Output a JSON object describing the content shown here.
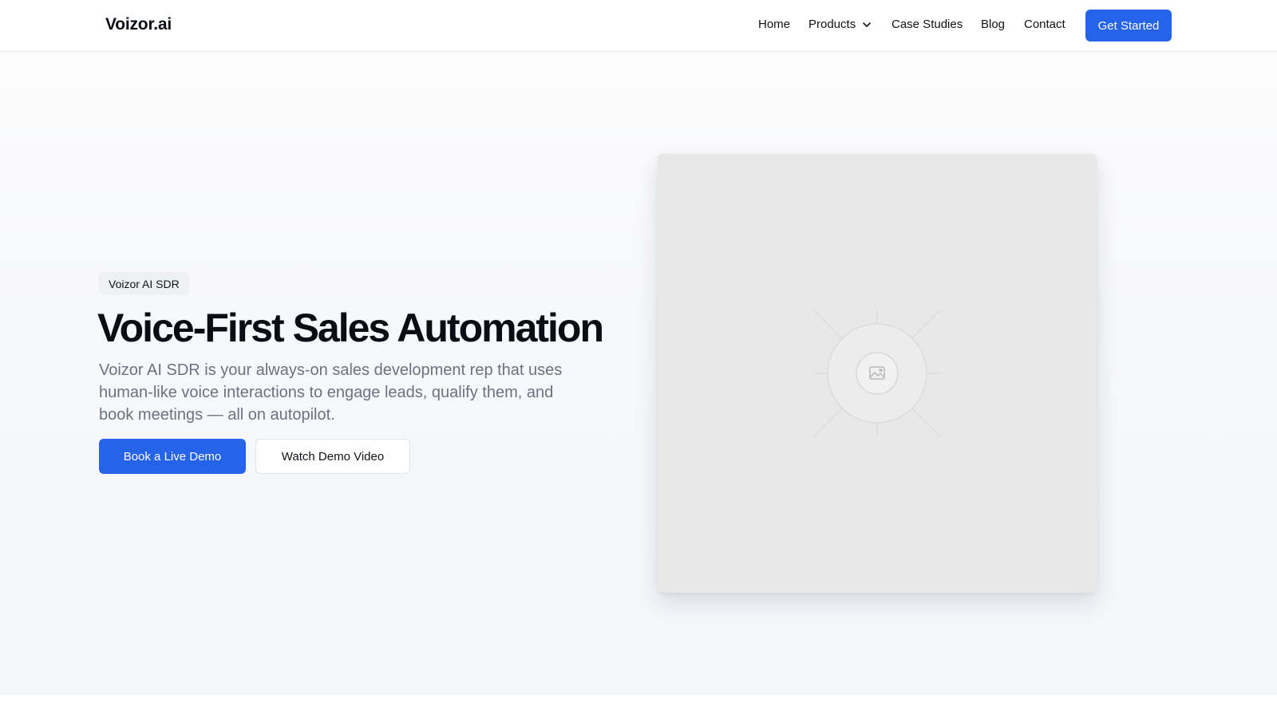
{
  "header": {
    "brand": "Voizor.ai",
    "nav": {
      "home": "Home",
      "products": "Products",
      "case_studies": "Case Studies",
      "blog": "Blog",
      "contact": "Contact"
    },
    "cta_label": "Get Started"
  },
  "hero": {
    "badge": "Voizor AI SDR",
    "headline": "Voice-First Sales Automation",
    "subtext": "Voizor AI SDR is your always-on sales development rep that uses human-like voice interactions to engage leads, qualify them, and book meetings — all on autopilot.",
    "primary_button": "Book a Live Demo",
    "secondary_button": "Watch Demo Video",
    "image_icon": "image-placeholder-icon"
  },
  "colors": {
    "accent": "#2563eb",
    "heading": "#0b0d14",
    "muted_text": "#6b7280",
    "placeholder_bg": "#e8e8e8"
  },
  "icons": {
    "products_dropdown": "chevron-down-icon"
  }
}
